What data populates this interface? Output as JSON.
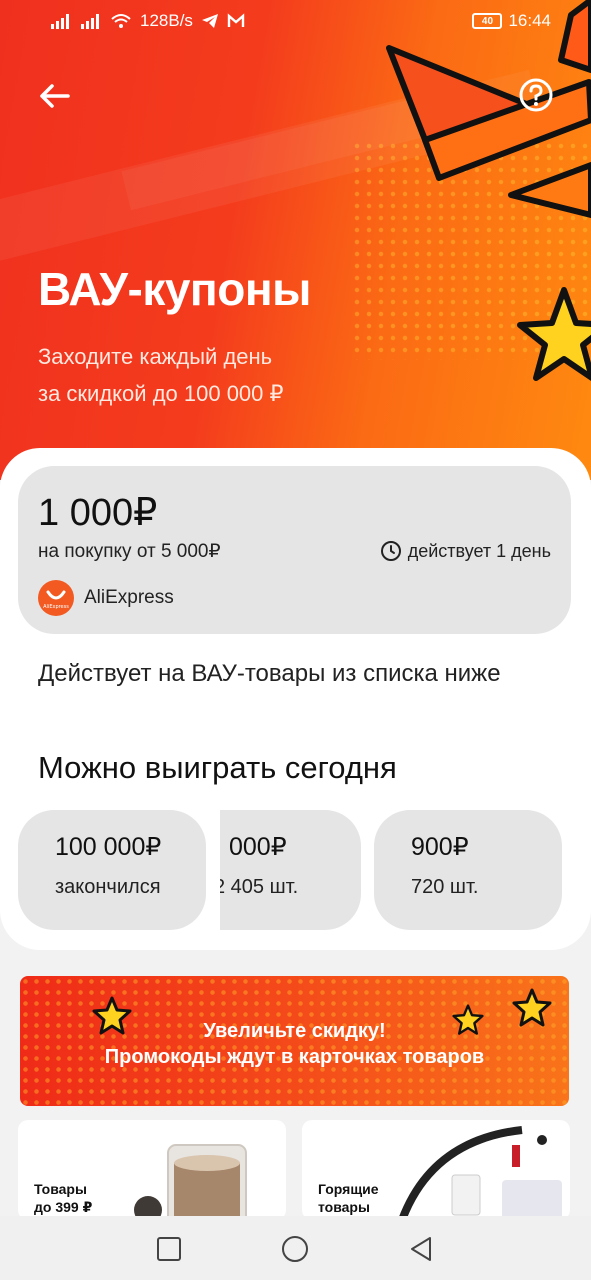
{
  "statusbar": {
    "network_speed": "128B/s",
    "battery": "40",
    "time": "16:44"
  },
  "header": {
    "back_icon": "arrow-left-icon",
    "help_icon": "question-circle-icon"
  },
  "hero": {
    "title": "ВАУ-купоны",
    "subtitle_line1": "Заходите каждый день",
    "subtitle_line2": "за скидкой до 100 000 ₽"
  },
  "coupon": {
    "amount": "1 000₽",
    "condition": "на покупку от 5 000₽",
    "validity": "действует 1 день",
    "seller": "AliExpress",
    "logo_text": "AliExpress"
  },
  "note": "Действует на ВАУ-товары из списка ниже",
  "section_title": "Можно выиграть сегодня",
  "prizes": [
    {
      "value": "100 000₽",
      "count": "закончился"
    },
    {
      "value": "000₽",
      "count": "2 405 шт."
    },
    {
      "value": "900₽",
      "count": "720 шт."
    }
  ],
  "promo": {
    "line1": "Увеличьте скидку!",
    "line2": "Промокоды ждут в карточках товаров"
  },
  "tiles": [
    {
      "line1": "Товары",
      "line2": "до 399 ₽"
    },
    {
      "line1": "Горящие",
      "line2": "товары"
    }
  ],
  "colors": {
    "brand_red": "#f0301e",
    "accent_orange": "#ff8a10",
    "star_yellow": "#ffd21f"
  }
}
